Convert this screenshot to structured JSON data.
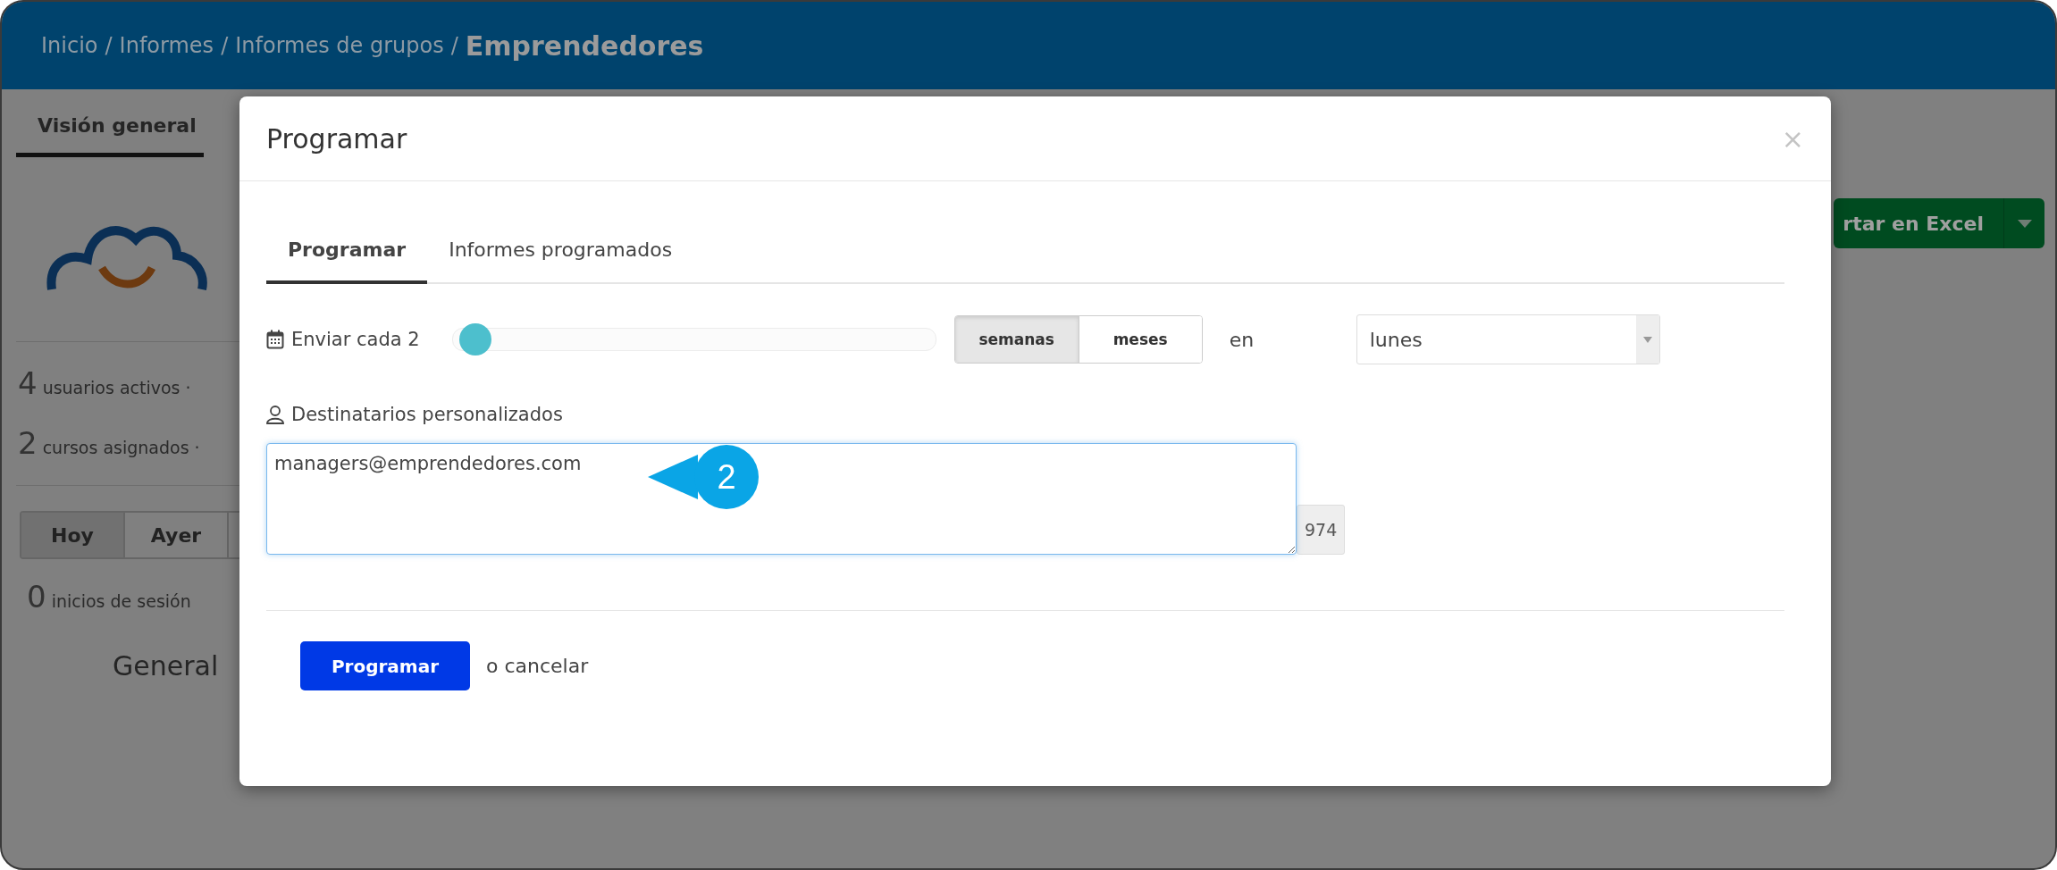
{
  "header": {
    "breadcrumb": [
      {
        "kind": "link",
        "text": "Inicio"
      },
      {
        "kind": "sep",
        "text": "/"
      },
      {
        "kind": "link",
        "text": "Informes"
      },
      {
        "kind": "sep",
        "text": "/"
      },
      {
        "kind": "link",
        "text": "Informes de grupos"
      },
      {
        "kind": "sep",
        "text": "/"
      },
      {
        "kind": "current",
        "text": "Emprendedores"
      }
    ]
  },
  "page": {
    "tabs": [
      {
        "label": "Visión general",
        "selected": true
      }
    ],
    "stats": [
      {
        "count": "4",
        "label": "usuarios activos ·"
      },
      {
        "count": "2",
        "label": "cursos asignados ·"
      }
    ],
    "periods": [
      {
        "label": "Hoy",
        "selected": true
      },
      {
        "label": "Ayer",
        "selected": false
      }
    ],
    "logins": {
      "count": "0",
      "label": "inicios de sesión"
    },
    "section_title": "General",
    "export_button": {
      "label": "rtar en Excel"
    }
  },
  "modal": {
    "title": "Programar",
    "close": "×",
    "tabs": [
      {
        "label": "Programar",
        "selected": true
      },
      {
        "label": "Informes programados",
        "selected": false
      }
    ],
    "frequency": {
      "label": "Enviar cada 2",
      "level": 0.03,
      "units": [
        {
          "label": "semanas",
          "selected": true
        },
        {
          "label": "meses",
          "selected": false
        }
      ],
      "on_label": "en",
      "day": {
        "value": "lunes"
      }
    },
    "recipients": {
      "label": "Destinatarios personalizados",
      "value": "managers@emprendedores.com",
      "counter": "974"
    },
    "submit": "Programar",
    "cancel": "o cancelar"
  },
  "callout": {
    "number": "2"
  }
}
